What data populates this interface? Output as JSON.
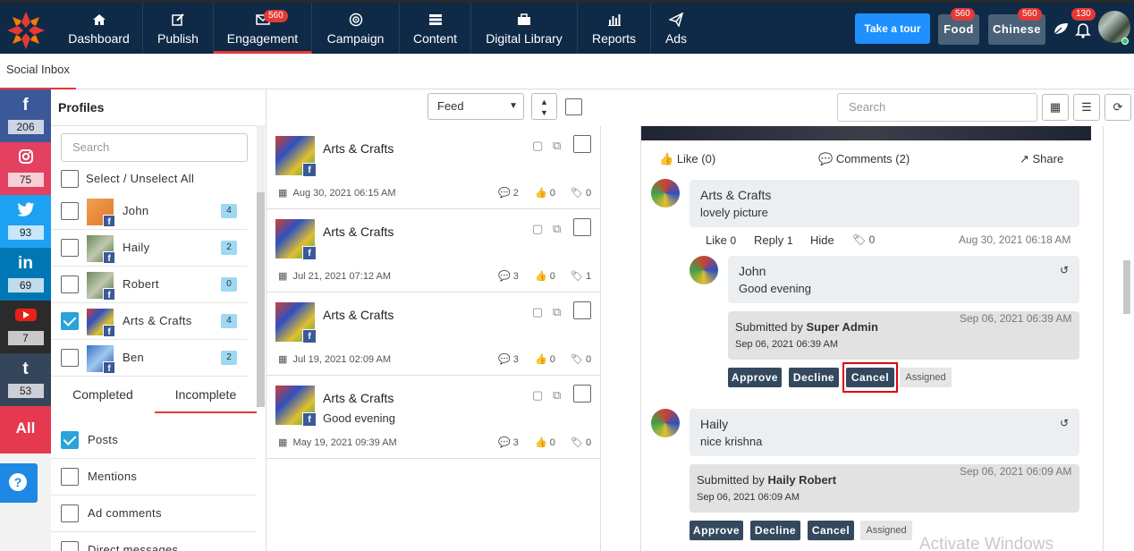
{
  "nav": {
    "items": [
      {
        "label": "Dashboard",
        "icon": "home-icon"
      },
      {
        "label": "Publish",
        "icon": "edit-icon"
      },
      {
        "label": "Engagement",
        "icon": "envelope-icon",
        "badge": "560"
      },
      {
        "label": "Campaign",
        "icon": "target-icon"
      },
      {
        "label": "Content",
        "icon": "list-icon"
      },
      {
        "label": "Digital Library",
        "icon": "briefcase-icon"
      },
      {
        "label": "Reports",
        "icon": "bar-chart-icon"
      },
      {
        "label": "Ads",
        "icon": "paper-plane-icon"
      }
    ],
    "tour": "Take a tour",
    "food": "Food",
    "food_badge": "560",
    "chinese": "Chinese",
    "chinese_badge": "560",
    "bell_badge": "130"
  },
  "subnav": {
    "tab": "Social Inbox"
  },
  "social": [
    {
      "name": "facebook",
      "glyph": "f",
      "count": "206",
      "color": "#3b5998"
    },
    {
      "name": "instagram",
      "glyph": "◎",
      "count": "75",
      "color": "#e4405f"
    },
    {
      "name": "twitter",
      "glyph": "🐦",
      "count": "93",
      "color": "#1da1f2"
    },
    {
      "name": "linkedin",
      "glyph": "in",
      "count": "69",
      "color": "#0077b5"
    },
    {
      "name": "youtube",
      "glyph": "▶",
      "count": "7",
      "color": "#2b2b2b"
    },
    {
      "name": "tumblr",
      "glyph": "t",
      "count": "53",
      "color": "#35465c"
    }
  ],
  "social_all": "All",
  "profiles": {
    "title": "Profiles",
    "search_placeholder": "Search",
    "select_all": "Select / Unselect All",
    "items": [
      {
        "name": "John",
        "count": "4",
        "checked": false
      },
      {
        "name": "Haily",
        "count": "2",
        "checked": false
      },
      {
        "name": "Robert",
        "count": "0",
        "checked": false
      },
      {
        "name": "Arts & Crafts",
        "count": "4",
        "checked": true
      },
      {
        "name": "Ben",
        "count": "2",
        "checked": false
      }
    ],
    "tab_completed": "Completed",
    "tab_incomplete": "Incomplete",
    "filters": [
      {
        "label": "Posts",
        "checked": true
      },
      {
        "label": "Mentions",
        "checked": false
      },
      {
        "label": "Ad comments",
        "checked": false
      },
      {
        "label": "Direct messages",
        "checked": false
      }
    ]
  },
  "feed": {
    "select": "Feed",
    "items": [
      {
        "title": "Arts & Crafts",
        "sub": "",
        "date": "Aug 30, 2021 06:15 AM",
        "comments": "2",
        "likes": "0",
        "tags": "0"
      },
      {
        "title": "Arts & Crafts",
        "sub": "",
        "date": "Jul 21, 2021 07:12 AM",
        "comments": "3",
        "likes": "0",
        "tags": "1"
      },
      {
        "title": "Arts & Crafts",
        "sub": "",
        "date": "Jul 19, 2021 02:09 AM",
        "comments": "3",
        "likes": "0",
        "tags": "0"
      },
      {
        "title": "Arts & Crafts",
        "sub": "Good evening",
        "date": "May 19, 2021 09:39 AM",
        "comments": "3",
        "likes": "0",
        "tags": "0"
      }
    ]
  },
  "detail": {
    "search_placeholder": "Search",
    "like": "Like (0)",
    "comments": "Comments (2)",
    "share": "Share",
    "comment1": {
      "name": "Arts & Crafts",
      "text": "lovely picture",
      "like": "Like",
      "like_count": "0",
      "reply": "Reply",
      "reply_count": "1",
      "hide": "Hide",
      "tag_count": "0",
      "date": "Aug 30, 2021 06:18 AM"
    },
    "reply1": {
      "name": "John",
      "text": "Good evening",
      "submitted_prefix": "Submitted by",
      "submitted_by": "Super Admin",
      "submitted_date": "Sep 06, 2021 06:39 AM",
      "sub_date": "Sep 06, 2021 06:39 AM"
    },
    "reply2": {
      "name": "Haily",
      "text": "nice krishna",
      "submitted_prefix": "Submitted by",
      "submitted_by": "Haily Robert",
      "submitted_date": "Sep 06, 2021 06:09 AM",
      "sub_date": "Sep 06, 2021 06:09 AM"
    },
    "approve": "Approve",
    "decline": "Decline",
    "cancel": "Cancel",
    "assigned": "Assigned",
    "highlight_color": "#e0000f"
  },
  "watermark": "Activate Windows"
}
